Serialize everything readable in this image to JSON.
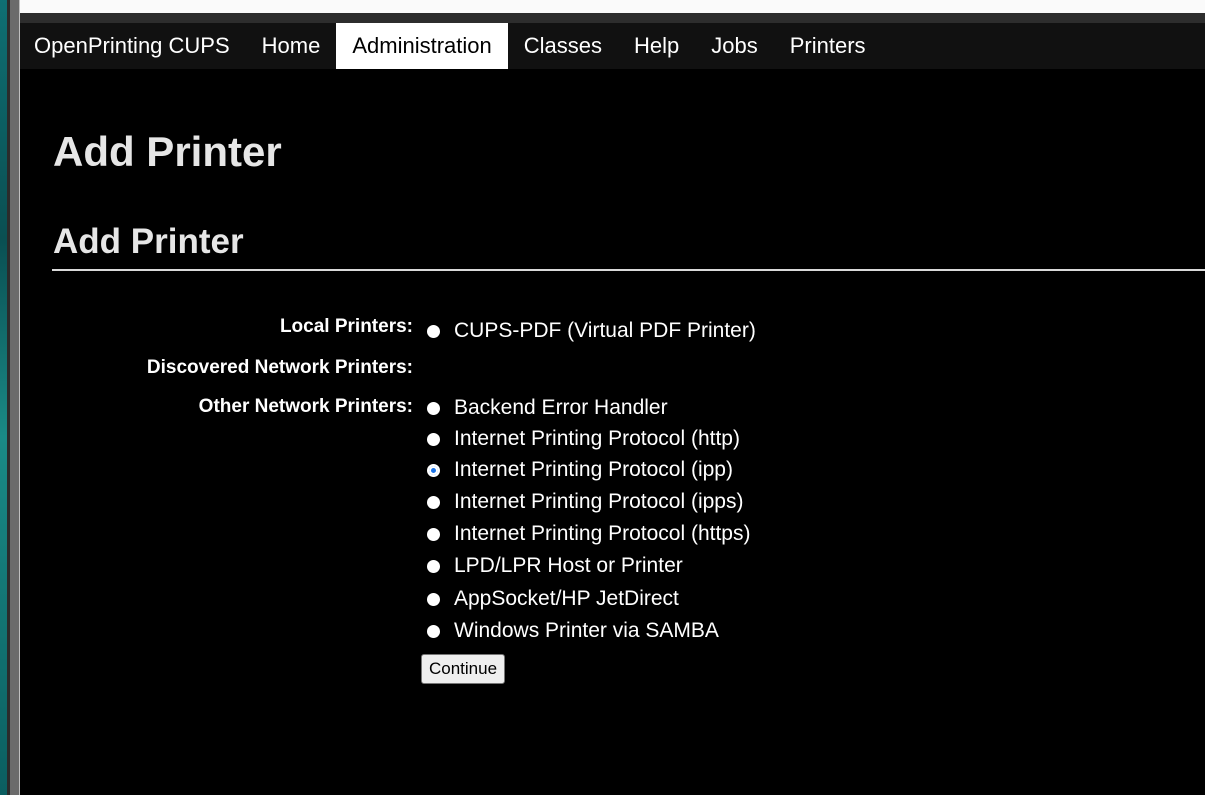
{
  "nav": {
    "items": [
      {
        "label": "OpenPrinting CUPS"
      },
      {
        "label": "Home"
      },
      {
        "label": "Administration"
      },
      {
        "label": "Classes"
      },
      {
        "label": "Help"
      },
      {
        "label": "Jobs"
      },
      {
        "label": "Printers"
      }
    ],
    "active": "Administration"
  },
  "page": {
    "title": "Add Printer",
    "section_title": "Add Printer"
  },
  "form": {
    "local_label": "Local Printers:",
    "discovered_label": "Discovered Network Printers:",
    "other_label": "Other Network Printers:",
    "local_options": [
      {
        "label": "CUPS-PDF (Virtual PDF Printer)",
        "checked": false
      }
    ],
    "other_options": [
      {
        "label": "Backend Error Handler",
        "checked": false
      },
      {
        "label": "Internet Printing Protocol (http)",
        "checked": false
      },
      {
        "label": "Internet Printing Protocol (ipp)",
        "checked": true
      },
      {
        "label": "Internet Printing Protocol (ipps)",
        "checked": false
      },
      {
        "label": "Internet Printing Protocol (https)",
        "checked": false
      },
      {
        "label": "LPD/LPR Host or Printer",
        "checked": false
      },
      {
        "label": "AppSocket/HP JetDirect",
        "checked": false
      },
      {
        "label": "Windows Printer via SAMBA",
        "checked": false
      }
    ],
    "continue_label": "Continue"
  },
  "colors": {
    "background": "#000000",
    "nav_active_bg": "#ffffff",
    "radio_selected": "#1a73e8"
  }
}
